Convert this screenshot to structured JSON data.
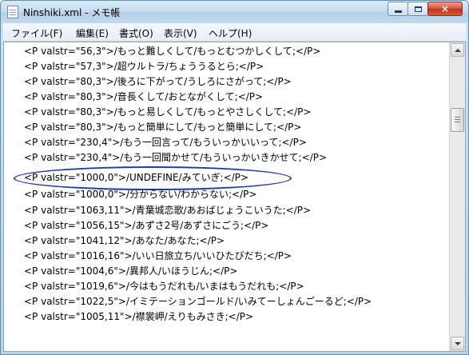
{
  "window": {
    "title": "Ninshiki.xml - メモ帳",
    "close_glyph": "×"
  },
  "menu": [
    {
      "label": "ファイル(F)"
    },
    {
      "label": "編集(E)"
    },
    {
      "label": "書式(O)"
    },
    {
      "label": "表示(V)"
    },
    {
      "label": "ヘルプ(H)"
    }
  ],
  "editor": {
    "lines": [
      "<P valstr=\"56,3\">/もっと難しくして/もっとむつかしくして;</P>",
      "<P valstr=\"57,3\">/超ウルトラ/ちょううるとら;</P>",
      "<P valstr=\"80,3\">/後ろに下がって/うしろにさがって;</P>",
      "<P valstr=\"80,3\">/音長くして/おとながくして;</P>",
      "<P valstr=\"80,3\">/もっと易しくして/もっとやさしくして;</P>",
      "<P valstr=\"80,3\">/もっと簡単にして/もっと簡単にして;</P>",
      "<P valstr=\"230,4\">/もう一回言って/もういっかいいって;</P>",
      "<P valstr=\"230,4\">/もう一回聞かせて/もういっかいきかせて;</P>",
      "<P valstr=\"1000,0\">/UNDEFINE/みていぎ;</P>",
      "<P valstr=\"1000,0\">/分からない/わからない;</P>",
      "<P valstr=\"1063,11\">/青葉城恋歌/あおばじょうこいうた;</P>",
      "<P valstr=\"1056,15\">/あずさ2号/あずさにごう;</P>",
      "<P valstr=\"1041,12\">/あなた/あなた;</P>",
      "<P valstr=\"1016,16\">/いい日旅立ち/いいひたびだち;</P>",
      "<P valstr=\"1004,6\">/異邦人/いほうじん;</P>",
      "<P valstr=\"1019,6\">/今はもうだれも/いまはもうだれも;</P>",
      "<P valstr=\"1022,5\">/イミテーションゴールド/いみてーしょんごーるど;</P>",
      "<P valstr=\"1005,11\">/襟裳岬/えりもみさき;</P>"
    ]
  },
  "colors": {
    "annotation_oval": "#1e3aa8",
    "titlebar": "#c4dcef",
    "close_button": "#c2351b"
  }
}
